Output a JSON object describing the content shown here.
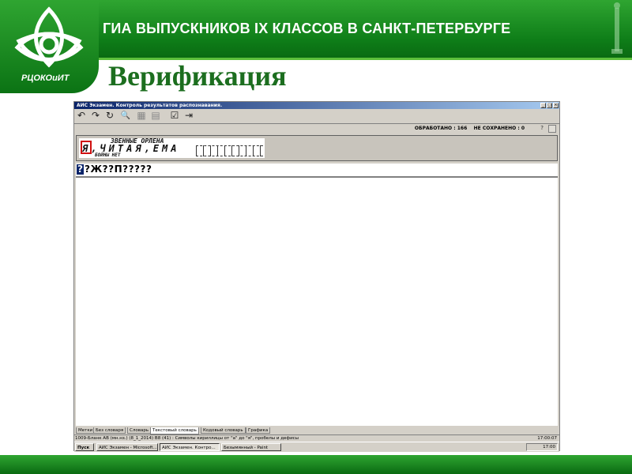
{
  "slide": {
    "header_title": "ГИА ВЫПУСКНИКОВ IX КЛАССОВ В САНКТ-ПЕТЕРБУРГЕ",
    "logo_text": "РЦОКОиИТ",
    "page_title": "Верификация",
    "colors": {
      "header_green": "#0e7d18",
      "title_green": "#1c6e1f",
      "accent_light": "#5cbf3a"
    }
  },
  "window": {
    "title": "АИС Экзамен. Контроль результатов распознавания.",
    "controls": {
      "minimize": "_",
      "maximize": "□",
      "close": "×"
    },
    "toolbar_icons": [
      "undo-icon",
      "redo-icon",
      "redo-all-icon",
      "search-icon",
      "paste-icon",
      "save-icon",
      "check-icon",
      "exit-icon"
    ],
    "toolbar_glyphs": [
      "↶",
      "↷",
      "↻",
      "🔍",
      "▦",
      "▤",
      "☑",
      "⇥"
    ],
    "status": {
      "processed": "ОБРАБОТАНО : 166",
      "not_saved": "НЕ СОХРАНЕНО : 0",
      "help": "?"
    },
    "scan": {
      "line1": "ЗВЕННЫЕ ОРЛЕНА",
      "line2": "Я,ЧИТАЯ,ЕМА",
      "line3": "БОЙНЫ НЕТ"
    },
    "recognized": {
      "cursor_char": "?",
      "text": "?Ж??П?????"
    },
    "tabs": [
      "Метки",
      "Без словаря",
      "Словарь",
      "Текстовый словарь",
      "Кодовый словарь",
      "Графика"
    ],
    "active_tab": "Текстовый словарь",
    "statusbar": {
      "info": "1009-Бланк АВ (мн.нз.) (8_1_2014)   В8 (41) : Символы кириллицы от \"а\" до \"я\", пробелы и дефисы",
      "time": "17:00:07"
    },
    "taskbar": {
      "start": "Пуск",
      "tasks": [
        "АИС Экзамен - Microsoft...",
        "АИС Экзамен. Контро...",
        "Безымянный - Paint"
      ],
      "clock": "17:00"
    }
  }
}
